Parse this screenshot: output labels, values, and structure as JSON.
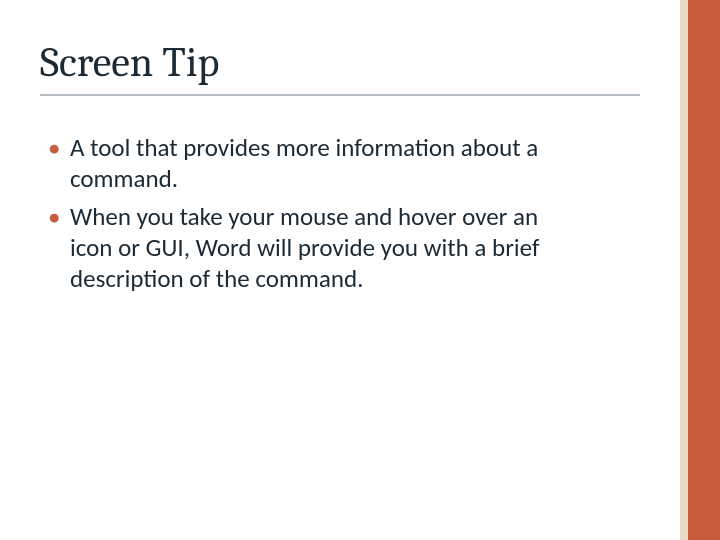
{
  "title": "Screen Tip",
  "bullets": [
    "A tool that provides more information about a command.",
    "When you take your mouse and hover over an icon or GUI, Word will provide you with a brief description of the command."
  ]
}
